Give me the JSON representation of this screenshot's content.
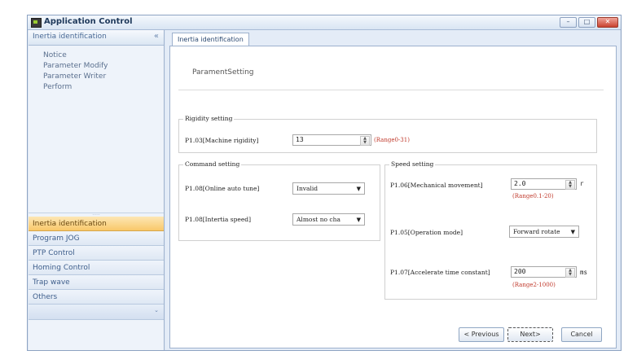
{
  "window": {
    "title": "Application Control",
    "controls": {
      "minimize": "–",
      "maximize": "□",
      "close": "✕"
    }
  },
  "sidebar": {
    "header": "Inertia identification",
    "collapse_glyph": "«",
    "items": [
      {
        "label": "Notice"
      },
      {
        "label": "Parameter Modify"
      },
      {
        "label": "Parameter Writer"
      },
      {
        "label": "Perform"
      }
    ],
    "grip": "·····",
    "nav": [
      {
        "label": "Inertia identification",
        "active": true
      },
      {
        "label": "Program JOG"
      },
      {
        "label": "PTP Control"
      },
      {
        "label": "Homing Control"
      },
      {
        "label": "Trap wave"
      },
      {
        "label": "Others"
      }
    ],
    "footer_glyph": "⌄"
  },
  "main": {
    "tab": "Inertia identification",
    "heading": "ParamentSetting",
    "rigidity": {
      "legend": "Rigidity setting",
      "label": "P1.03[Machine rigidity]",
      "value": "13",
      "range": "(Range0-31)"
    },
    "command": {
      "legend": "Command setting",
      "online_label": "P1.08[Online auto tune]",
      "online_value": "Invalid",
      "inertia_label": "P1.08[Intertia speed]",
      "inertia_value": "Almost no cha"
    },
    "speed": {
      "legend": "Speed setting",
      "mech_label": "P1.06[Mechanical movement]",
      "mech_value": "2.0",
      "mech_unit": "r",
      "mech_range": "(Range0.1-20)",
      "op_label": "P1.05[Operation mode]",
      "op_value": "Forward rotate",
      "accel_label": "P1.07[Accelerate time constant]",
      "accel_value": "200",
      "accel_unit": "ms",
      "accel_range": "(Range2-1000)"
    },
    "buttons": {
      "previous": "< Previous",
      "next": "Next>",
      "cancel": "Cancel"
    }
  }
}
